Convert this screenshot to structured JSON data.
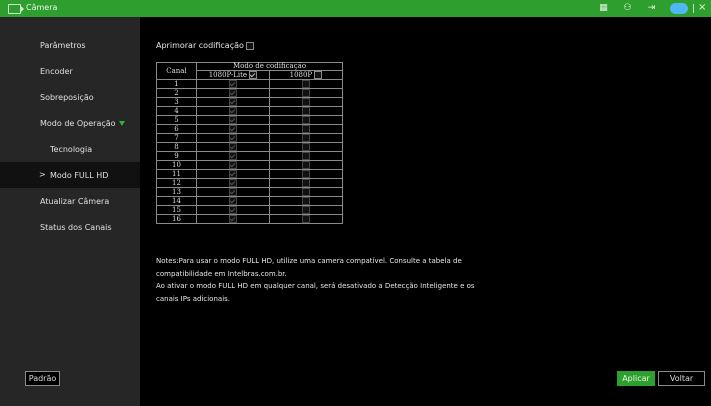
{
  "window": {
    "title": "Câmera"
  },
  "topbar_icons": [
    "calendar-icon",
    "users-icon",
    "logout-icon",
    "cloud-icon",
    "close-icon"
  ],
  "cloud_label": "",
  "sidebar": {
    "items": [
      {
        "label": "Parâmetros"
      },
      {
        "label": "Encoder"
      },
      {
        "label": "Sobreposição"
      },
      {
        "label": "Modo de Operação",
        "expanded": true
      },
      {
        "label": "Tecnologia",
        "sub": true
      },
      {
        "label": "Modo FULL HD",
        "sub": true,
        "active": true,
        "prefix": ">"
      },
      {
        "label": "Atualizar Câmera"
      },
      {
        "label": "Status dos Canais"
      }
    ]
  },
  "main": {
    "improve_label": "Aprimorar codificação",
    "table": {
      "col_channel": "Canal",
      "group_header": "Modo de codificação",
      "col1": "1080P-Lite",
      "col2": "1080P",
      "rows": [
        "1",
        "2",
        "3",
        "4",
        "5",
        "6",
        "7",
        "8",
        "9",
        "10",
        "11",
        "12",
        "13",
        "14",
        "15",
        "16"
      ]
    },
    "notes": [
      "Notes:Para usar o modo FULL HD, utilize uma camera compatível. Consulte a tabela de",
      "compatibilidade em Intelbras.com.br.",
      "Ao ativar o modo FULL HD em qualquer canal, será desativado a Detecção Inteligente e os",
      "canais IPs adicionais."
    ]
  },
  "buttons": {
    "default": "Padrão",
    "apply": "Aplicar",
    "back": "Voltar"
  },
  "colors": {
    "accent": "#2e9e2e",
    "sidebar_bg": "#262626",
    "background": "#000000"
  }
}
